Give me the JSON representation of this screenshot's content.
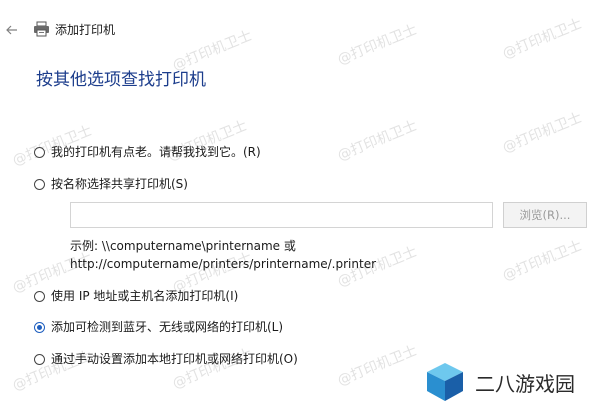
{
  "window": {
    "title": "添加打印机"
  },
  "heading": "按其他选项查找打印机",
  "options": [
    {
      "label": "我的打印机有点老。请帮我找到它。(R)",
      "checked": false
    },
    {
      "label": "按名称选择共享打印机(S)",
      "checked": false
    },
    {
      "label": "使用 IP 地址或主机名添加打印机(I)",
      "checked": false
    },
    {
      "label": "添加可检测到蓝牙、无线或网络的打印机(L)",
      "checked": true
    },
    {
      "label": "通过手动设置添加本地打印机或网络打印机(O)",
      "checked": false
    }
  ],
  "share": {
    "value": "",
    "browse_label": "浏览(R)...",
    "example_line1": "示例: \\\\computername\\printername 或",
    "example_line2": "http://computername/printers/printername/.printer"
  },
  "watermark": "@打印机卫士",
  "logo": {
    "text": "二八游戏园"
  },
  "colors": {
    "heading": "#1c3d8c",
    "accent": "#1f5fbf"
  }
}
